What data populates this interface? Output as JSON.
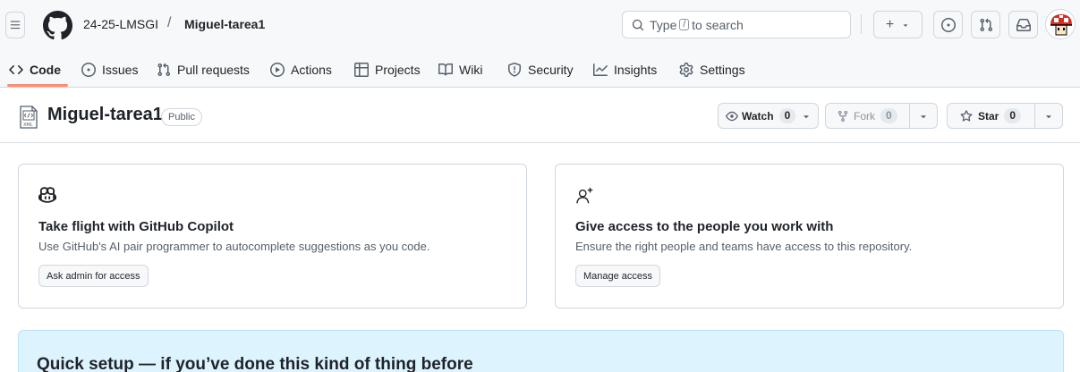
{
  "header": {
    "owner": "24-25-LMSGI",
    "separator": "/",
    "repo": "Miguel-tarea1",
    "search_prefix": "Type",
    "search_key": "/",
    "search_suffix": "to search",
    "plus_label": "+"
  },
  "nav": {
    "tabs": [
      {
        "label": "Code",
        "icon": "code-icon"
      },
      {
        "label": "Issues",
        "icon": "issue-opened-icon"
      },
      {
        "label": "Pull requests",
        "icon": "git-pull-request-icon"
      },
      {
        "label": "Actions",
        "icon": "play-icon"
      },
      {
        "label": "Projects",
        "icon": "table-icon"
      },
      {
        "label": "Wiki",
        "icon": "book-icon"
      },
      {
        "label": "Security",
        "icon": "shield-icon"
      },
      {
        "label": "Insights",
        "icon": "graph-icon"
      },
      {
        "label": "Settings",
        "icon": "gear-icon"
      }
    ],
    "active_tab": "Code"
  },
  "repo": {
    "name": "Miguel-tarea1",
    "visibility": "Public",
    "watch_label": "Watch",
    "watch_count": "0",
    "fork_label": "Fork",
    "fork_count": "0",
    "star_label": "Star",
    "star_count": "0"
  },
  "cards": [
    {
      "icon": "copilot-icon",
      "title": "Take flight with GitHub Copilot",
      "description": "Use GitHub's AI pair programmer to autocomplete suggestions as you code.",
      "button": "Ask admin for access"
    },
    {
      "icon": "person-add-icon",
      "title": "Give access to the people you work with",
      "description": "Ensure the right people and teams have access to this repository.",
      "button": "Manage access"
    }
  ],
  "quick_setup": {
    "title": "Quick setup — if you’ve done this kind of thing before"
  },
  "colors": {
    "accent_underline": "#fd8c73",
    "quick_setup_bg": "#ddf4ff",
    "header_bg": "#f6f8fa",
    "border": "#d0d7de"
  }
}
